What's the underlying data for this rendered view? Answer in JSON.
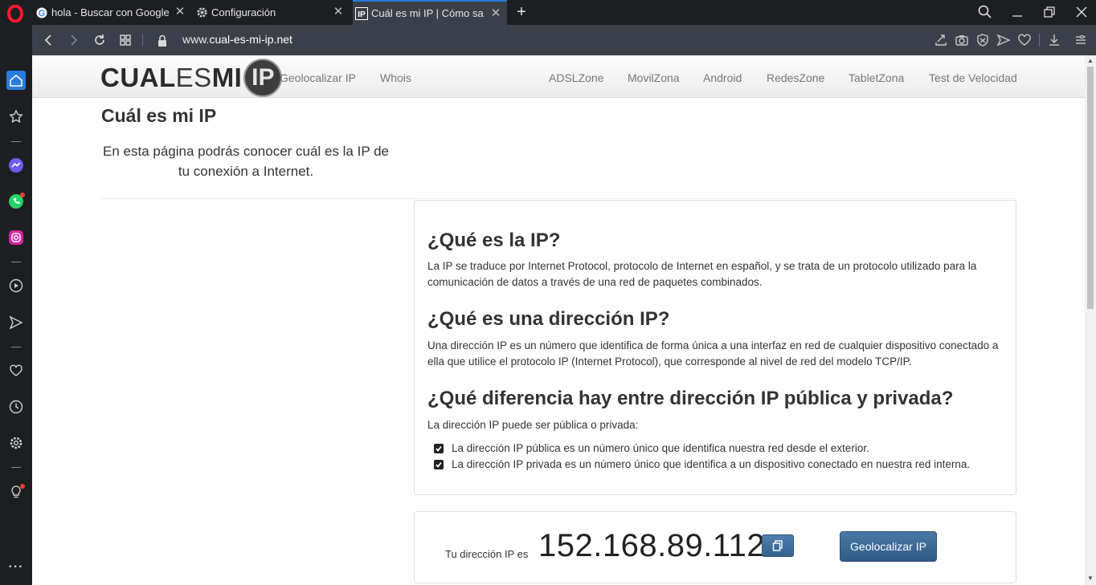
{
  "browser": {
    "tabs": [
      {
        "label": "hola - Buscar con Google",
        "favicon": "google-icon",
        "active": false
      },
      {
        "label": "Configuración",
        "favicon": "gear-icon",
        "active": false
      },
      {
        "label": "Cuál es mi IP | Cómo saber",
        "favicon": "ip-site-icon",
        "active": true
      }
    ],
    "url_prefix": "www.",
    "url_domain": "cual-es-mi-ip.net",
    "accent_color": "#2a7bde"
  },
  "sidebar": {
    "items": [
      "home-icon",
      "bookmarks-icon",
      "messenger-icon",
      "whatsapp-icon",
      "instagram-icon",
      "player-icon",
      "send-icon",
      "heart-icon",
      "history-icon",
      "settings-icon",
      "lightbulb-icon",
      "more-icon"
    ]
  },
  "site": {
    "brand_bold1": "CUAL",
    "brand_light": "ES",
    "brand_bold2": "MI",
    "brand_circle": "IP",
    "nav_left": [
      "Geolocalizar IP",
      "Whois"
    ],
    "nav_right": [
      "ADSLZone",
      "MovilZona",
      "Android",
      "RedesZone",
      "TabletZona",
      "Test de Velocidad"
    ]
  },
  "main": {
    "title": "Cuál es mi IP",
    "intro": "En esta página podrás conocer cuál es la IP de tu conexión a Internet.",
    "sections": [
      {
        "heading": "¿Qué es la IP?",
        "text": "La IP se traduce por Internet Protocol, protocolo de Internet en español, y se trata de un protocolo utilizado para la comunicación de datos a través de una red de paquetes combinados."
      },
      {
        "heading": "¿Qué es una dirección IP?",
        "text": "Una dirección IP es un número que identifica de forma única a una interfaz en red de cualquier dispositivo conectado a ella que utilice el protocolo IP (Internet Protocol), que corresponde al nivel de red del modelo TCP/IP."
      },
      {
        "heading": "¿Qué diferencia hay entre dirección IP pública y privada?",
        "text": "La dirección IP puede ser pública o privada:"
      }
    ],
    "checks": [
      "La dirección IP pública es un número único que identifica nuestra red desde el exterior.",
      "La dirección IP privada es un número único que identifica a un dispositivo conectado en nuestra red interna."
    ],
    "ip_label": "Tu dirección IP es",
    "ip_value": "152.168.89.112",
    "geo_button": "Geolocalizar IP",
    "button_color": "#33628e"
  }
}
